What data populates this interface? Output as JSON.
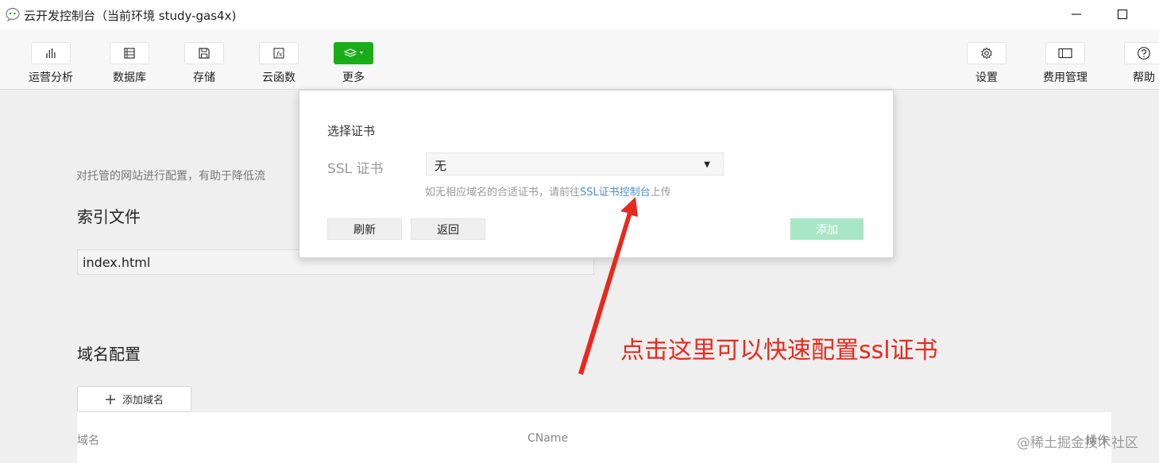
{
  "window": {
    "title": "云开发控制台（当前环境 study-gas4x)"
  },
  "toolbar": {
    "left": [
      {
        "label": "运营分析",
        "icon": "bar-chart-icon"
      },
      {
        "label": "数据库",
        "icon": "database-icon"
      },
      {
        "label": "存储",
        "icon": "storage-icon"
      },
      {
        "label": "云函数",
        "icon": "function-icon"
      },
      {
        "label": "更多",
        "icon": "layers-icon"
      }
    ],
    "right": [
      {
        "label": "设置",
        "icon": "gear-icon"
      },
      {
        "label": "费用管理",
        "icon": "billing-icon"
      },
      {
        "label": "帮助",
        "icon": "help-icon"
      }
    ]
  },
  "main": {
    "description": "对托管的网站进行配置，有助于降低流",
    "index_section": {
      "title": "索引文件",
      "value": "index.html"
    },
    "domain_section": {
      "title": "域名配置",
      "add_button": "添加域名",
      "columns": [
        "域名",
        "CName",
        "操作"
      ]
    }
  },
  "dialog": {
    "title": "选择证书",
    "ssl_label": "SSL 证书",
    "ssl_selected": "无",
    "hint_prefix": "如无相应域名的合适证书，请前往",
    "hint_link": "SSL证书控制台",
    "hint_suffix": "上传",
    "refresh_button": "刷新",
    "back_button": "返回",
    "add_button": "添加"
  },
  "annotation": {
    "text": "点击这里可以快速配置ssl证书",
    "color": "#e8291e"
  },
  "watermark": {
    "text": "@稀土掘金技术社区"
  },
  "colors": {
    "accent_green": "#1aad19",
    "link_blue": "#4a8ed6"
  }
}
